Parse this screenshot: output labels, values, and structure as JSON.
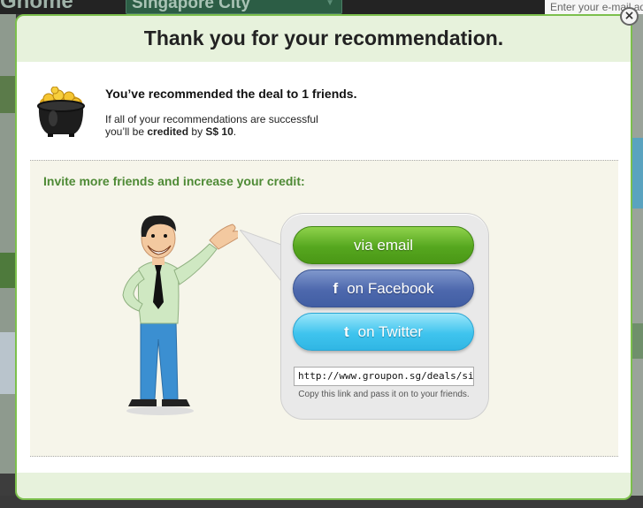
{
  "background": {
    "brand_fragment": "Gnome",
    "city_selector": "Singapore City",
    "email_placeholder": "Enter your e-mail ad"
  },
  "modal": {
    "title": "Thank you for your recommendation.",
    "close_label": "×",
    "recommended": "You’ve recommended the deal to 1 friends.",
    "credit_line1": "If all of your recommendations are successful",
    "credit_line2_prefix": "you’ll be ",
    "credit_line2_bold": "credited",
    "credit_line2_mid": " by ",
    "credit_amount": "S$ 10",
    "credit_line2_suffix": ".",
    "invite_title": "Invite more friends and increase your credit:",
    "share": {
      "email_label": "via email",
      "facebook_label": "on Facebook",
      "facebook_icon": "f",
      "twitter_label": "on Twitter",
      "twitter_icon": "t",
      "link_value": "http://www.groupon.sg/deals/singa",
      "link_help": "Copy this link and pass it on to your friends."
    }
  },
  "colors": {
    "accent_green": "#7cbf4c",
    "invite_title": "#4e8a35",
    "email_button": "#56a71f",
    "facebook_button": "#4d68ad",
    "twitter_button": "#3fc4ee"
  }
}
